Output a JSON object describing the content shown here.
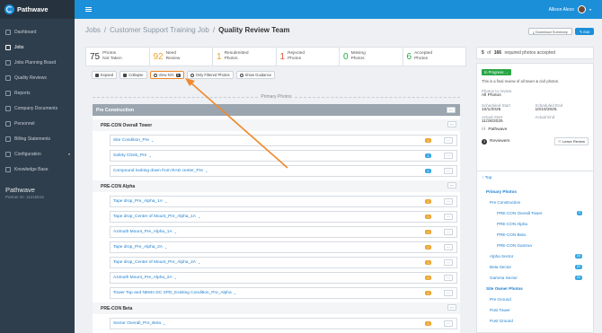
{
  "app": {
    "name": "Pathwave",
    "partner_name": "Pathwave",
    "partner_id": "Partner ID: 11216519"
  },
  "sidebar": {
    "items": [
      {
        "label": "Dashboard",
        "icon": "dashboard-icon"
      },
      {
        "label": "Jobs",
        "icon": "tools-icon",
        "active": true
      },
      {
        "label": "Jobs Planning Board",
        "icon": "board-icon"
      },
      {
        "label": "Quality Reviews",
        "icon": "image-icon"
      },
      {
        "label": "Reports",
        "icon": "chart-icon"
      },
      {
        "label": "Company Documents",
        "icon": "folder-icon"
      },
      {
        "label": "Personnel",
        "icon": "people-icon"
      },
      {
        "label": "Billing Statements",
        "icon": "billing-icon"
      },
      {
        "label": "Configuration",
        "icon": "gear-icon",
        "caret": true
      },
      {
        "label": "Knowledge Base",
        "icon": "help-icon"
      }
    ]
  },
  "topbar": {
    "user_name": "Allison Alexo"
  },
  "breadcrumb": {
    "jobs": "Jobs",
    "job": "Customer Support Training Job",
    "current": "Quality Review Team",
    "sep": "/"
  },
  "header_buttons": {
    "download": "Download Summary",
    "edit": "Edit"
  },
  "stats": [
    {
      "n": "75",
      "l1": "Photos",
      "l2": "Not Taken",
      "color": "#333333"
    },
    {
      "n": "92",
      "l1": "Need",
      "l2": "Review",
      "color": "#e8a530"
    },
    {
      "n": "1",
      "l1": "Resubmitted",
      "l2": "Photos",
      "color": "#e8a530"
    },
    {
      "n": "1",
      "l1": "Rejected",
      "l2": "Photos",
      "color": "#e0533d"
    },
    {
      "n": "0",
      "l1": "Missing",
      "l2": "Photos",
      "color": "#28a745"
    },
    {
      "n": "6",
      "l1": "Accepted",
      "l2": "Photos",
      "color": "#28a745"
    }
  ],
  "toolbar": {
    "expand": "Expand",
    "collapse": "Collapse",
    "view_na": "View N/A",
    "view_na_badge": "0",
    "filtered": "Only Filtered Photos",
    "guidance": "Show Guidance"
  },
  "primary_label": "Primary Photos",
  "tree": {
    "section": "Pre Construction",
    "groups": [
      {
        "title": "PRE-CON Overall Tower",
        "rows": [
          {
            "label": "Site Condition_Pre",
            "count": "0",
            "color": "y"
          },
          {
            "label": "Safety Climb_Pre",
            "count": "1",
            "color": "b"
          },
          {
            "label": "Compound looking down from RAD center_Pre",
            "count": "1",
            "color": "b"
          }
        ]
      },
      {
        "title": "PRE-CON Alpha",
        "rows": [
          {
            "label": "Tape drop_Pre_Alpha_1A",
            "count": "0",
            "color": "y"
          },
          {
            "label": "Tape drop_Center of Mount_Pre_Alpha_1A",
            "count": "0",
            "color": "y"
          },
          {
            "label": "Azimuth Mount_Pre_Alpha_1A",
            "count": "0",
            "color": "y"
          },
          {
            "label": "Tape drop_Pre_Alpha_2A",
            "count": "0",
            "color": "y"
          },
          {
            "label": "Tape drop_Center of Mount_Pre_Alpha_2A",
            "count": "0",
            "color": "y"
          },
          {
            "label": "Azimuth Mount_Pre_Alpha_2A",
            "count": "0",
            "color": "y"
          },
          {
            "label": "Tower Top and NEMA DC SPD_Existing Condition_Pre_Alpha",
            "count": "0",
            "color": "y"
          }
        ]
      },
      {
        "title": "PRE-CON Beta",
        "rows": [
          {
            "label": "Sector Overall_Pre_Beta",
            "count": "0",
            "color": "y"
          }
        ]
      }
    ]
  },
  "right": {
    "accepted_a": "5",
    "accepted_of": "of",
    "accepted_b": "166",
    "accepted_text": "required photos accepted",
    "status": "In Progress",
    "final_note": "This is a final review of all tower & civil photos.",
    "photos_label": "Photos to review",
    "photos_value": "All Photos",
    "sched_start_l": "Scheduled Start",
    "sched_start_v": "10/1/2025",
    "sched_end_l": "Scheduled End",
    "sched_end_v": "10/10/2025",
    "act_start_l": "Actual Start",
    "act_start_v": "11/28/2025",
    "act_end_l": "Actual End",
    "act_end_v": "",
    "company": "Pathwave",
    "reviewers_count": "3",
    "reviewers_label": "Reviewers",
    "leave": "Leave Review",
    "toc_top": "Top",
    "toc": [
      {
        "label": "Primary Photos",
        "lvl": "l0",
        "badge": ""
      },
      {
        "label": "Pre Construction",
        "lvl": "l1",
        "badge": ""
      },
      {
        "label": "PRE-CON Overall Tower",
        "lvl": "l2",
        "badge": "2"
      },
      {
        "label": "PRE-CON Alpha",
        "lvl": "l2",
        "badge": ""
      },
      {
        "label": "PRE-CON Beta",
        "lvl": "l2",
        "badge": ""
      },
      {
        "label": "PRE-CON Gamma",
        "lvl": "l2",
        "badge": ""
      },
      {
        "label": "Alpha Sector",
        "lvl": "l1",
        "badge": "24"
      },
      {
        "label": "Beta Sector",
        "lvl": "l1",
        "badge": "21"
      },
      {
        "label": "Gamma Sector",
        "lvl": "l1",
        "badge": "21"
      },
      {
        "label": "Site Owner Photos",
        "lvl": "l0",
        "badge": ""
      },
      {
        "label": "Pre Ground",
        "lvl": "l1",
        "badge": ""
      },
      {
        "label": "Post Tower",
        "lvl": "l1",
        "badge": ""
      },
      {
        "label": "Post Ground",
        "lvl": "l1",
        "badge": ""
      }
    ]
  },
  "colors": {
    "accent": "#1c8fd9",
    "arrow": "#f0892c",
    "sidebar": "#2f3e4c"
  }
}
